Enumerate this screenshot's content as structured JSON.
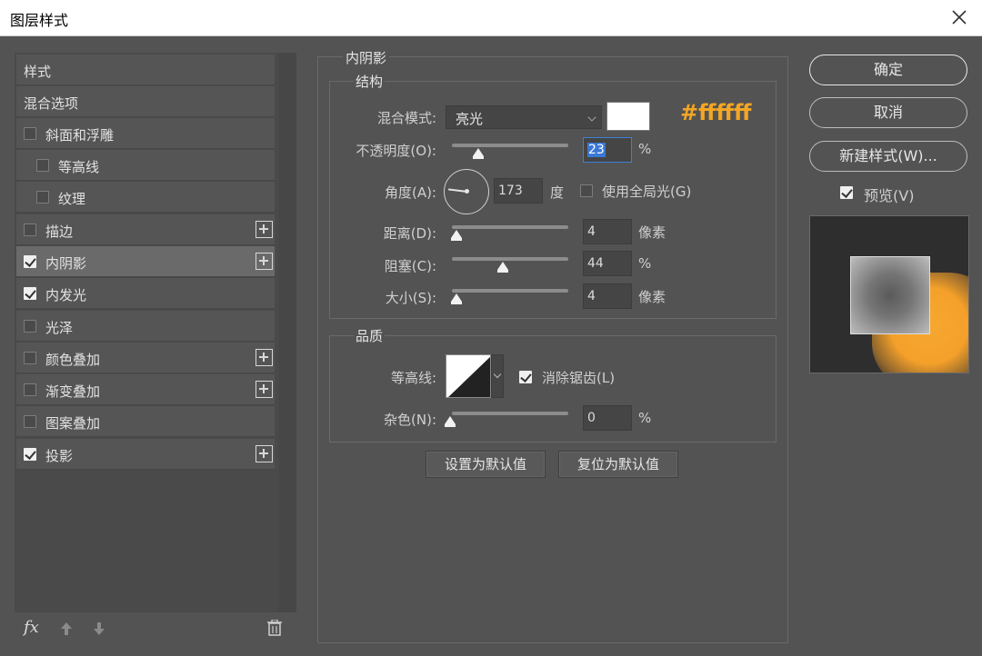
{
  "window": {
    "title": "图层样式"
  },
  "style_list": {
    "items": [
      {
        "label": "样式",
        "checkbox": null,
        "plus": false
      },
      {
        "label": "混合选项",
        "checkbox": null,
        "plus": false
      },
      {
        "label": "斜面和浮雕",
        "checkbox": false,
        "plus": false
      },
      {
        "label": "等高线",
        "checkbox": false,
        "plus": false
      },
      {
        "label": "纹理",
        "checkbox": false,
        "plus": false
      },
      {
        "label": "描边",
        "checkbox": false,
        "plus": true
      },
      {
        "label": "内阴影",
        "checkbox": true,
        "plus": true,
        "active": true
      },
      {
        "label": "内发光",
        "checkbox": true,
        "plus": false
      },
      {
        "label": "光泽",
        "checkbox": false,
        "plus": false
      },
      {
        "label": "颜色叠加",
        "checkbox": false,
        "plus": true
      },
      {
        "label": "渐变叠加",
        "checkbox": false,
        "plus": true
      },
      {
        "label": "图案叠加",
        "checkbox": false,
        "plus": false
      },
      {
        "label": "投影",
        "checkbox": true,
        "plus": true
      }
    ],
    "fx_label": "fx"
  },
  "inner_shadow": {
    "title": "内阴影",
    "structure": {
      "title": "结构",
      "blend_mode_label": "混合模式:",
      "blend_mode_value": "亮光",
      "color": "#ffffff",
      "color_note": "#ffffff",
      "opacity_label": "不透明度(O):",
      "opacity_value": "23",
      "opacity_unit": "%",
      "opacity_fraction": 0.23,
      "angle_label": "角度(A):",
      "angle_value": "173",
      "angle_unit": "度",
      "global_light_label": "使用全局光(G)",
      "global_light_checked": false,
      "distance_label": "距离(D):",
      "distance_value": "4",
      "distance_unit": "像素",
      "choke_label": "阻塞(C):",
      "choke_value": "44",
      "choke_unit": "%",
      "size_label": "大小(S):",
      "size_value": "4",
      "size_unit": "像素"
    },
    "quality": {
      "title": "品质",
      "contour_label": "等高线:",
      "antialias_label": "消除锯齿(L)",
      "antialias_checked": true,
      "noise_label": "杂色(N):",
      "noise_value": "0",
      "noise_unit": "%"
    },
    "make_default_label": "设置为默认值",
    "reset_default_label": "复位为默认值"
  },
  "actions": {
    "ok_label": "确定",
    "cancel_label": "取消",
    "new_style_label": "新建样式(W)...",
    "preview_label": "预览(V)",
    "preview_checked": true
  },
  "colors": {
    "accent_note": "#f5a623",
    "glow": "#f4a02a",
    "background": "#535353"
  }
}
